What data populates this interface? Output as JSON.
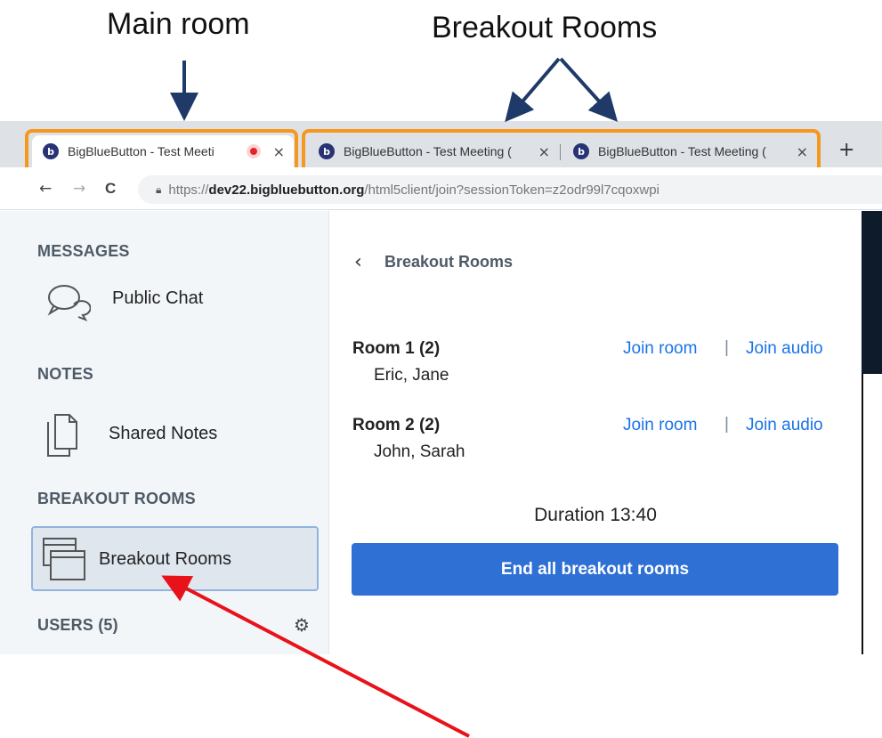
{
  "annotations": {
    "main_room": "Main room",
    "breakout_rooms": "Breakout Rooms"
  },
  "browser": {
    "tabs": [
      {
        "label": "BigBlueButton - Test Meeti",
        "favicon": "bigbluebutton-logo",
        "recording": true,
        "close": "×"
      },
      {
        "label": "BigBlueButton - Test Meeting (",
        "favicon": "bigbluebutton-logo",
        "close": "×"
      },
      {
        "label": "BigBlueButton - Test Meeting (",
        "favicon": "bigbluebutton-logo",
        "close": "×"
      }
    ],
    "new_tab": "+",
    "nav": {
      "back": "←",
      "forward": "→",
      "reload": "C"
    },
    "url": {
      "scheme": "https://",
      "host": "dev22.bigbluebutton.org",
      "path": "/html5client/join?sessionToken=z2odr99l7cqoxwpi"
    }
  },
  "sidebar": {
    "messages": {
      "title": "MESSAGES",
      "items": [
        {
          "label": "Public Chat",
          "icon": "chat-icon"
        }
      ]
    },
    "notes": {
      "title": "NOTES",
      "items": [
        {
          "label": "Shared Notes",
          "icon": "notes-icon"
        }
      ]
    },
    "breakout": {
      "title": "BREAKOUT ROOMS",
      "items": [
        {
          "label": "Breakout Rooms",
          "icon": "breakout-windows-icon",
          "active": true
        }
      ]
    },
    "users": {
      "title": "USERS (5)",
      "settings_icon": "gear-icon"
    }
  },
  "panel": {
    "title": "Breakout Rooms",
    "rooms": [
      {
        "name": "Room 1 (2)",
        "users": "Eric, Jane",
        "join_room": "Join room",
        "separator": "|",
        "join_audio": "Join audio"
      },
      {
        "name": "Room 2 (2)",
        "users": "John, Sarah",
        "join_room": "Join room",
        "separator": "|",
        "join_audio": "Join audio"
      }
    ],
    "duration": "Duration 13:40",
    "end_button": "End all breakout rooms"
  },
  "colors": {
    "highlight_box": "#f5981d",
    "arrow_red": "#e8121b",
    "arrow_blue": "#1f3a68",
    "link_blue": "#1a73e8",
    "button_blue": "#2f70d4"
  }
}
